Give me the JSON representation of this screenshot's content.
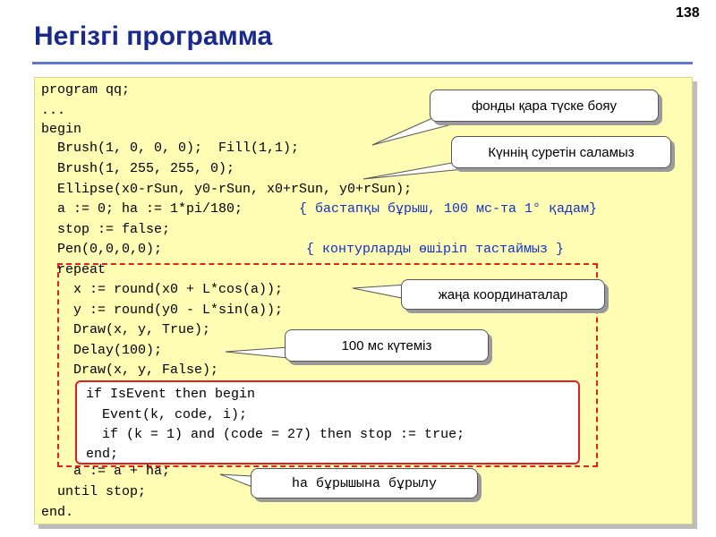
{
  "slide": {
    "page_number": "138",
    "title": "Негізгі программа"
  },
  "code": {
    "l1": "program qq;",
    "l2": "...",
    "l3": "begin",
    "l4": "  Brush(1, 0, 0, 0);  Fill(1,1);",
    "l5": "  Brush(1, 255, 255, 0);",
    "l6": "  Ellipse(x0-rSun, y0-rSun, x0+rSun, y0+rSun);",
    "l7": "  a := 0; ha := 1*pi/180;",
    "l7_comment": "{ бастапқы бұрыш, 100 мс-та 1° қадам}",
    "l8": "  stop := false;",
    "l9": "  Pen(0,0,0,0);",
    "l9_comment": "{ контурларды өшіріп тастаймыз }",
    "l10": "  repeat",
    "l11": "    x := round(x0 + L*cos(a));",
    "l12": "    y := round(y0 - L*sin(a));",
    "l13": "    Draw(x, y, True);",
    "l14": "    Delay(100);",
    "l15": "    Draw(x, y, False);",
    "e1": "if IsEvent then begin",
    "e2": "  Event(k, code, i);",
    "e3": "  if (k = 1) and (code = 27) then stop := true;",
    "e4": "end;",
    "l16": "    a := a + ha;",
    "l17": "  until stop;",
    "l18": "end."
  },
  "callouts": {
    "background": "фонды қара түске бояу",
    "sun": "Күннің суретін саламыз",
    "coords": "жаңа координаталар",
    "wait": "100 мс күтеміз",
    "rotate": "ha бұрышына бұрылу"
  }
}
